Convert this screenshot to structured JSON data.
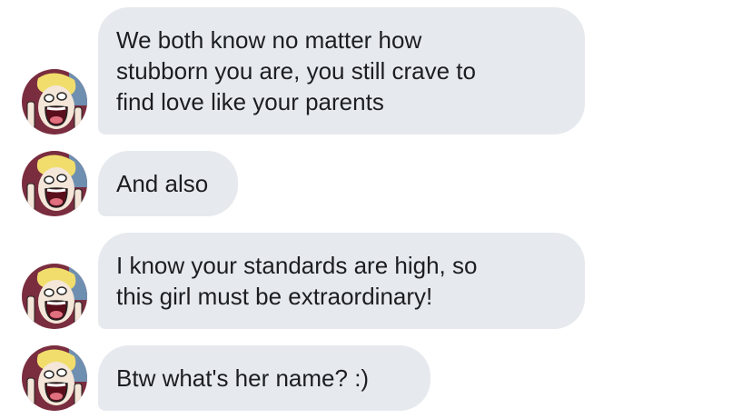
{
  "conversation": {
    "contact_avatar": "avatar-icon",
    "bubble_color": "#e6eaee",
    "text_color": "#1c1e21",
    "messages": [
      {
        "lines": [
          "We both know no matter how",
          "stubborn you are, you still crave to",
          "find love like your parents"
        ]
      },
      {
        "lines": [
          "And also"
        ]
      },
      {
        "lines": [
          "I know your standards are high, so",
          "this girl must be extraordinary!"
        ]
      },
      {
        "lines": [
          "Btw what's her name? :)"
        ]
      }
    ]
  }
}
